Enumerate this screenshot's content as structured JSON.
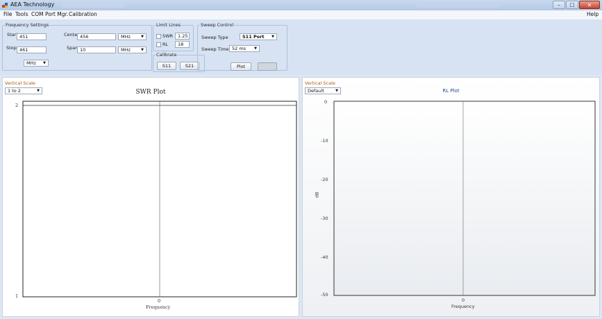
{
  "window": {
    "title": "AEA Technology",
    "controls": {
      "minimize": "–",
      "maximize": "☐",
      "close": "✕"
    }
  },
  "menu": {
    "items": [
      "File",
      "Tools",
      "COM Port Mgr.",
      "Calibration"
    ],
    "help": "Help"
  },
  "frequency_settings": {
    "legend": "Frequency Settings",
    "start_label": "Start",
    "start_value": "451",
    "stop_label": "Stop",
    "stop_value": "461",
    "center_label": "Center",
    "center_value": "456",
    "center_unit": "MHz",
    "span_label": "Span",
    "span_value": "10",
    "span_unit": "MHz",
    "unit_select": "MHz"
  },
  "limit_lines": {
    "legend": "Limit Lines",
    "swr_label": "SWR",
    "swr_value": "1.25",
    "rl_label": "RL",
    "rl_value": "18"
  },
  "calibrate": {
    "legend": "Calibrate",
    "s11_label": "S11",
    "s21_label": "S21"
  },
  "sweep_control": {
    "legend": "Sweep Control",
    "type_label": "Sweep Type",
    "type_value": "S11 Port",
    "time_label": "Sweep Time",
    "time_value": "52 ms",
    "plot_label": "Plot",
    "stop_label": ""
  },
  "swr_panel": {
    "vertical_scale_label": "Vertical Scale",
    "scale_value": "1 to 2",
    "chart_data": {
      "type": "line",
      "title": "SWR Plot",
      "xlabel": "Frequency",
      "ylabel": "",
      "ylim": [
        1,
        2
      ],
      "x_ticks": [
        "0"
      ],
      "y_ticks": [
        "2",
        "1"
      ],
      "grid": true,
      "series": []
    }
  },
  "rl_panel": {
    "vertical_scale_label": "Vertical Scale",
    "scale_value": "Default",
    "chart_data": {
      "type": "line",
      "title": "RL Plot",
      "xlabel": "Frequency",
      "ylabel": "dB",
      "ylim": [
        -50,
        0
      ],
      "x_ticks": [
        "0"
      ],
      "y_ticks": [
        "0",
        "-10",
        "-20",
        "-30",
        "-40",
        "-50"
      ],
      "grid": true,
      "series": []
    }
  },
  "colors": {
    "toolbar_bg": "#d7e3f3",
    "vertical_scale_text": "#b05a10",
    "rl_title": "#1f4a8a"
  }
}
